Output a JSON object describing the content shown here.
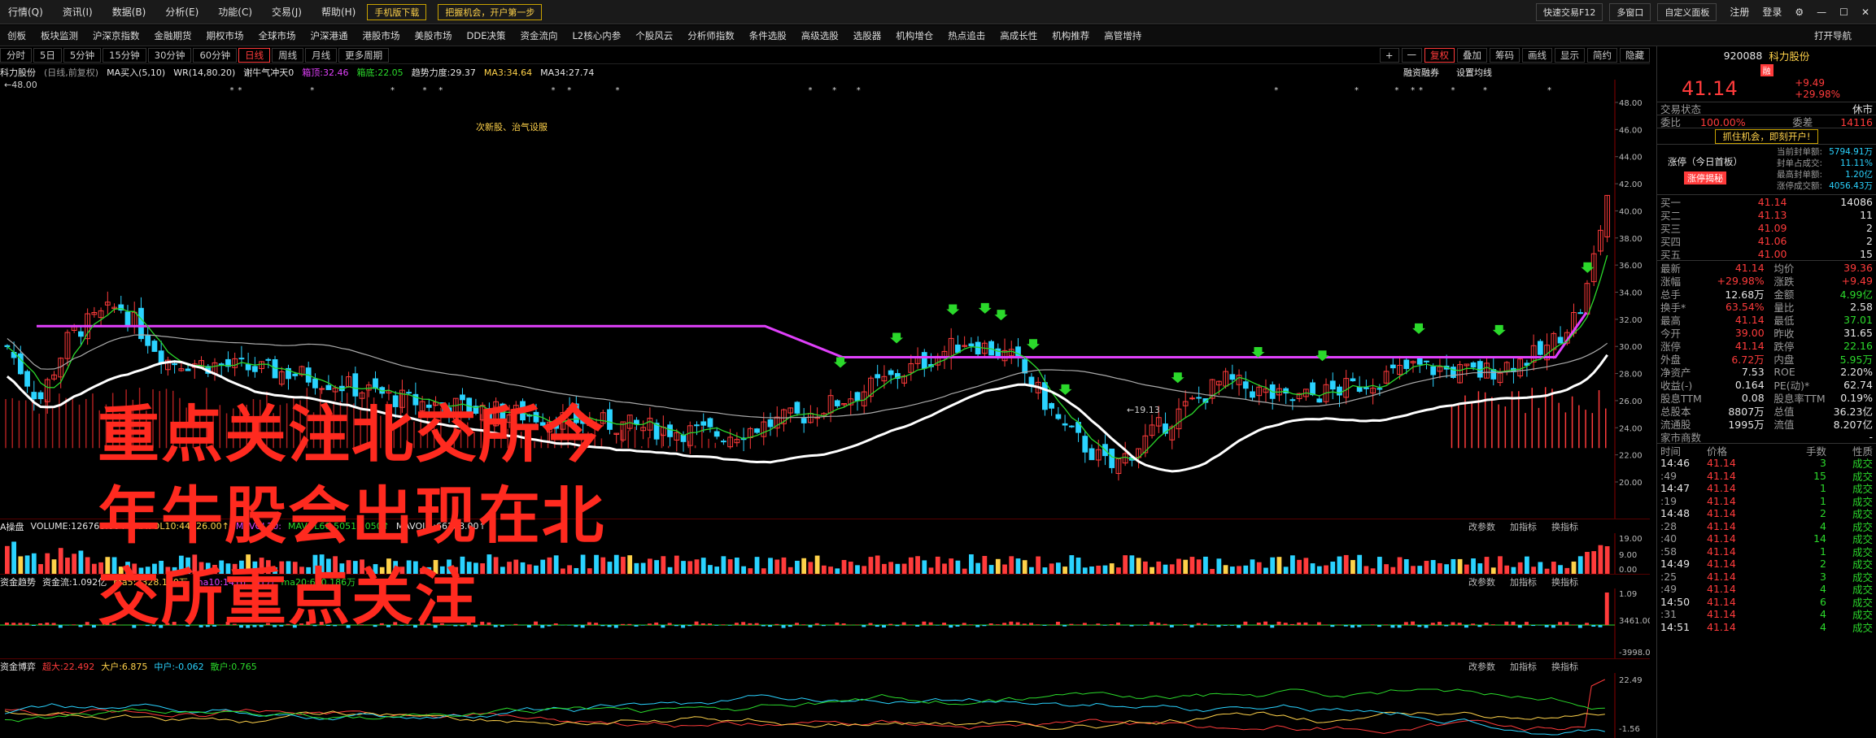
{
  "menu": {
    "items": [
      "行情(Q)",
      "资讯(I)",
      "数据(B)",
      "分析(E)",
      "功能(C)",
      "交易(J)",
      "帮助(H)"
    ],
    "promo1": "手机版下载",
    "promo2": "把握机会，开户第一步",
    "right_buttons": [
      "快速交易F12",
      "多窗口",
      "自定义面板"
    ],
    "right_text": [
      "注册",
      "登录"
    ]
  },
  "nav": {
    "items": [
      "创板",
      "板块监测",
      "沪深京指数",
      "金融期货",
      "期权市场",
      "全球市场",
      "沪深港通",
      "港股市场",
      "美股市场",
      "DDE决策",
      "资金流向",
      "L2核心内参",
      "个股风云",
      "分析师指数",
      "条件选股",
      "高级选股",
      "选股器",
      "机构增仓",
      "热点追击",
      "高成长性",
      "机构推荐",
      "高管增持"
    ],
    "right": "打开导航"
  },
  "period": {
    "tabs": [
      "分时",
      "5日",
      "5分钟",
      "15分钟",
      "30分钟",
      "60分钟",
      "日线",
      "周线",
      "月线",
      "更多周期"
    ],
    "active": "日线",
    "tools": [
      "+",
      "一",
      "复权",
      "叠加",
      "筹码",
      "画线",
      "显示",
      "简约",
      "隐藏"
    ]
  },
  "info": {
    "name": "科力股份",
    "mode": "(日线,前复权)",
    "mab": "MA买入(5,10)",
    "wr": "WR(14,80.20)",
    "bull": "谢牛气冲天0",
    "box_top": "箱顶:32.46",
    "box_bottom": "箱底:22.05",
    "trend": "趋势力度:29.37",
    "ma3": "MA3:34.64",
    "ma34": "MA34:27.74",
    "r1": "融资融券",
    "r2": "设置均线"
  },
  "chart": {
    "price_ticks": [
      "48.00",
      "46.00",
      "44.00",
      "42.00",
      "40.00",
      "38.00",
      "36.00",
      "34.00",
      "32.00",
      "30.00",
      "28.00",
      "26.00",
      "24.00",
      "22.00",
      "20.00"
    ],
    "ref_label": "←48.00",
    "annotation": "次新股、治气设服",
    "low_label": "←19.13",
    "vol_title": [
      "A操盘",
      "VOLUME:126768.00↑",
      "MAVOL10:44826.00↑",
      "MAVOL20:",
      "MAVOL60:50518.050↑",
      "MAVOL5:66208.00↑"
    ],
    "vol_ticks": [
      "19.00",
      "9.00",
      "0.00"
    ],
    "flow_title": [
      "资金趋势",
      "资金流:1.092亿",
      "ma5:2328.100万",
      "ma10:1416.361万",
      "ma20:670.186万"
    ],
    "flow_ticks": [
      "1.09",
      "3461.00",
      "-3998.00"
    ],
    "game_title": [
      "资金博弈",
      "超大:22.492",
      "大户:6.875",
      "中户:-0.062",
      "散户:0.765"
    ],
    "game_ticks": [
      "22.49",
      "-1.56"
    ],
    "panel_btns": [
      "改参数",
      "加指标",
      "换指标"
    ]
  },
  "overlay": [
    "重点关注北交所今",
    "年牛股会出现在北",
    "交所重点关注"
  ],
  "stock": {
    "code": "920088",
    "name": "科力股份",
    "badge": "融",
    "price": "41.14",
    "change": "+9.49",
    "pct": "+29.98%",
    "status_label": "交易状态",
    "status": "休市",
    "webi_label": "委比",
    "webi": "100.00%",
    "weicha_label": "委差",
    "weicha": "14116",
    "promo": "抓住机会，即刻开户!",
    "limit_label": "涨停（今日首板）",
    "limit_btn": "涨停揭秘",
    "limit_rows": [
      [
        "当前封单额:",
        "5794.91万"
      ],
      [
        "封单占成交:",
        "11.11%"
      ],
      [
        "最高封单额:",
        "1.20亿"
      ],
      [
        "涨停成交额:",
        "4056.43万"
      ]
    ],
    "bids": [
      [
        "买一",
        "41.14",
        "14086"
      ],
      [
        "买二",
        "41.13",
        "11"
      ],
      [
        "买三",
        "41.09",
        "2"
      ],
      [
        "买四",
        "41.06",
        "2"
      ],
      [
        "买五",
        "41.00",
        "15"
      ]
    ],
    "quotes": [
      [
        "最新",
        "41.14",
        "均价",
        "39.36"
      ],
      [
        "涨幅",
        "+29.98%",
        "涨跌",
        "+9.49"
      ],
      [
        "总手",
        "12.68万",
        "金额",
        "4.99亿"
      ],
      [
        "换手*",
        "63.54%",
        "量比",
        "2.58"
      ],
      [
        "最高",
        "41.14",
        "最低",
        "37.01"
      ],
      [
        "今开",
        "39.00",
        "昨收",
        "31.65"
      ],
      [
        "涨停",
        "41.14",
        "跌停",
        "22.16"
      ],
      [
        "外盘",
        "6.72万",
        "内盘",
        "5.95万"
      ],
      [
        "净资产",
        "7.53",
        "ROE",
        "2.20%"
      ],
      [
        "收益(-)",
        "0.164",
        "PE(动)*",
        "62.74"
      ],
      [
        "股息TTM",
        "0.08",
        "股息率TTM",
        "0.19%"
      ],
      [
        "总股本",
        "8807万",
        "总值",
        "36.23亿"
      ],
      [
        "流通股",
        "1995万",
        "流值",
        "8.207亿"
      ],
      [
        "家市商数",
        "",
        "",
        "-"
      ]
    ],
    "ticks_header": [
      "时间",
      "价格",
      "手数",
      "性质"
    ],
    "ticks": [
      [
        "14:46",
        "41.14",
        "3",
        "成交"
      ],
      [
        ":49",
        "41.14",
        "15",
        "成交"
      ],
      [
        "14:47",
        "41.14",
        "1",
        "成交"
      ],
      [
        ":19",
        "41.14",
        "1",
        "成交"
      ],
      [
        "14:48",
        "41.14",
        "2",
        "成交"
      ],
      [
        ":28",
        "41.14",
        "4",
        "成交"
      ],
      [
        ":40",
        "41.14",
        "14",
        "成交"
      ],
      [
        ":58",
        "41.14",
        "1",
        "成交"
      ],
      [
        "14:49",
        "41.14",
        "2",
        "成交"
      ],
      [
        ":25",
        "41.14",
        "3",
        "成交"
      ],
      [
        ":49",
        "41.14",
        "4",
        "成交"
      ],
      [
        "14:50",
        "41.14",
        "6",
        "成交"
      ],
      [
        ":31",
        "41.14",
        "4",
        "成交"
      ],
      [
        "14:51",
        "41.14",
        "4",
        "成交"
      ]
    ]
  },
  "colors": {
    "up": "#ff3b3b",
    "down": "#2ad3ff",
    "ma_green": "#2bd92b",
    "box": "#e040fb",
    "white_line": "#ffffff"
  }
}
